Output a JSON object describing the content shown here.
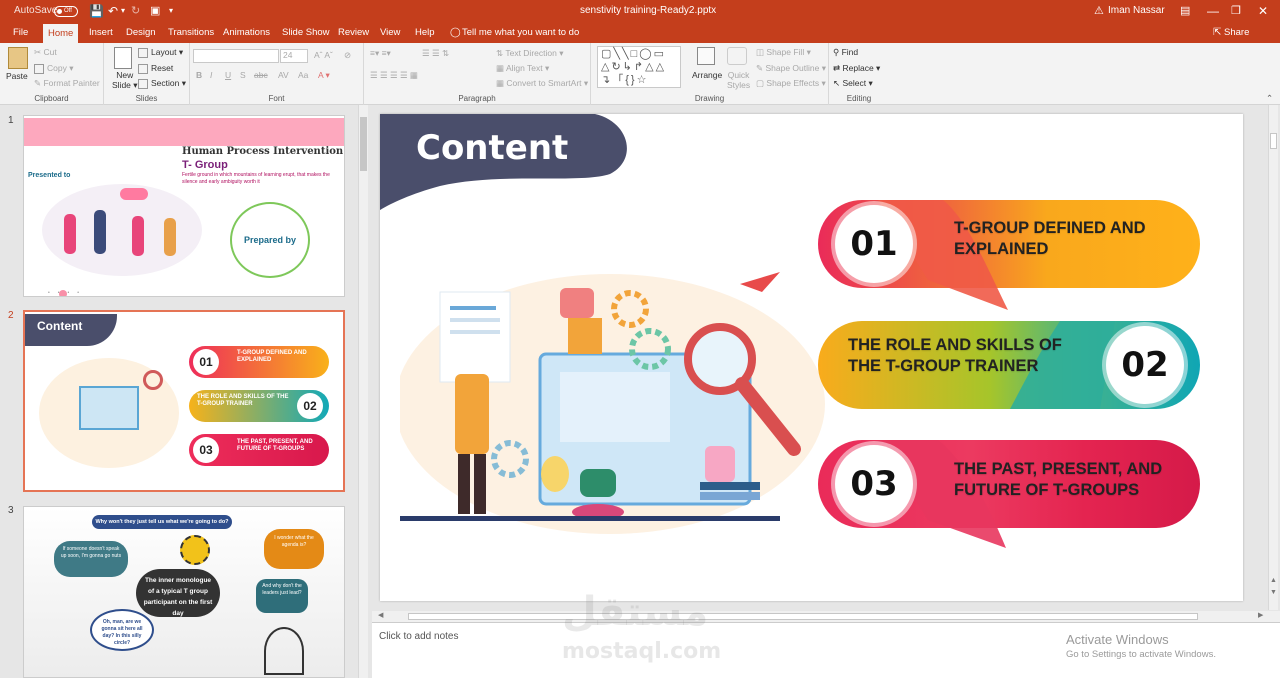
{
  "titlebar": {
    "autosave": "AutoSave",
    "autosave_state": "Off",
    "filename": "senstivity training-Ready2.pptx",
    "user": "Iman Nassar"
  },
  "tabs": [
    "File",
    "Home",
    "Insert",
    "Design",
    "Transitions",
    "Animations",
    "Slide Show",
    "Review",
    "View",
    "Help"
  ],
  "tell_me": "Tell me what you want to do",
  "share": "Share",
  "ribbon": {
    "clipboard": {
      "paste": "Paste",
      "cut": "Cut",
      "copy": "Copy",
      "format_painter": "Format Painter",
      "label": "Clipboard"
    },
    "slides": {
      "new_slide": "New",
      "new_slide2": "Slide",
      "layout": "Layout",
      "reset": "Reset",
      "section": "Section",
      "label": "Slides"
    },
    "font": {
      "size": "24",
      "label": "Font"
    },
    "paragraph": {
      "text_direction": "Text Direction",
      "align_text": "Align Text",
      "smartart": "Convert to SmartArt",
      "label": "Paragraph"
    },
    "drawing": {
      "arrange": "Arrange",
      "quick_styles": "Quick",
      "quick_styles2": "Styles",
      "shape_fill": "Shape Fill",
      "shape_outline": "Shape Outline",
      "shape_effects": "Shape Effects",
      "label": "Drawing"
    },
    "editing": {
      "find": "Find",
      "replace": "Replace",
      "select": "Select",
      "label": "Editing"
    }
  },
  "thumbnails": [
    {
      "num": "1",
      "title": "Human Process Intervention",
      "subtitle": "T- Group",
      "desc": "Fertile ground in which mountains of learning erupt, that makes the silence and early ambiguity worth it",
      "presented": "Presented to",
      "prepared": "Prepared by"
    },
    {
      "num": "2",
      "title": "Content",
      "items": [
        "T-GROUP DEFINED AND EXPLAINED",
        "THE ROLE AND SKILLS OF THE T-GROUP TRAINER",
        "THE PAST, PRESENT, AND FUTURE OF T-GROUPS"
      ],
      "nums": [
        "01",
        "02",
        "03"
      ]
    },
    {
      "num": "3",
      "q1": "Why won't they just tell us what we're going to do?",
      "q2": "If someone doesn't speak up soon, I'm gonna go nuts",
      "q3": "I wonder what the agenda is?",
      "center": "The inner monologue of a typical T group participant on the first day",
      "q4": "And why don't the leaders just lead?",
      "q5": "Oh, man, are we gonna sit here all day? In this silly circle?"
    }
  ],
  "slide": {
    "title": "Content",
    "items": [
      {
        "num": "01",
        "text": "T-GROUP DEFINED AND EXPLAINED"
      },
      {
        "num": "02",
        "text": "THE ROLE AND SKILLS OF THE T-GROUP TRAINER"
      },
      {
        "num": "03",
        "text": "THE PAST, PRESENT, AND FUTURE OF T-GROUPS"
      }
    ]
  },
  "notes_placeholder": "Click to add notes",
  "activate": {
    "title": "Activate Windows",
    "sub": "Go to Settings to activate Windows."
  },
  "watermark": {
    "arabic": "مستقل",
    "latin": "mostaql.com"
  },
  "colors": {
    "accent": "#c43e1c",
    "pink": "#e8245b",
    "orange": "#f7a51b",
    "teal": "#10a6b4",
    "navy": "#4a4e6b"
  }
}
